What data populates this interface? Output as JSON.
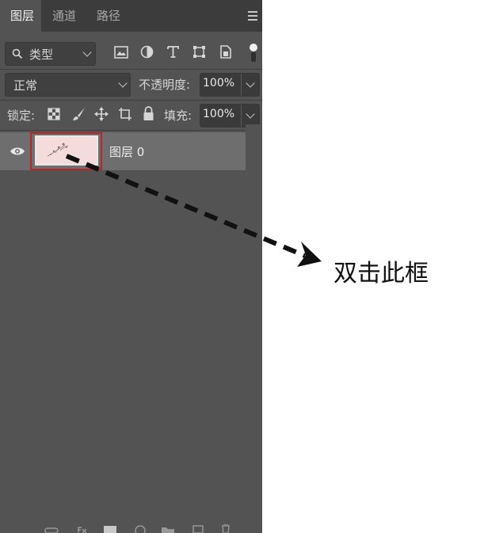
{
  "tabs": [
    {
      "label": "图层"
    },
    {
      "label": "通道"
    },
    {
      "label": "路径"
    }
  ],
  "filter": {
    "label": "类型"
  },
  "blend_mode": {
    "label": "正常"
  },
  "opacity": {
    "label": "不透明度:",
    "value": "100%"
  },
  "lock": {
    "label": "锁定:"
  },
  "fill": {
    "label": "填充:",
    "value": "100%"
  },
  "layers": [
    {
      "name": "图层 0",
      "visible": true
    }
  ],
  "bottom_icons": [
    "link-icon",
    "fx-icon",
    "mask-icon",
    "adjustment-icon",
    "folder-icon",
    "new-layer-icon",
    "trash-icon"
  ],
  "annotation": {
    "text": "双击此框"
  },
  "colors": {
    "selection_border": "#b8262a",
    "thumbnail_bg": "#f4dcdc",
    "panel_bg": "#535353"
  }
}
